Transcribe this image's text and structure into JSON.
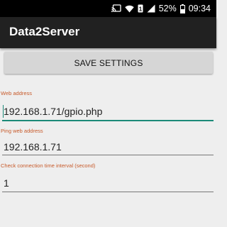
{
  "status_bar": {
    "battery_percent": "52%",
    "time": "09:34",
    "icons": [
      "cast-icon",
      "wifi-icon",
      "sim-1-icon",
      "signal-icon",
      "battery-icon"
    ]
  },
  "app_bar": {
    "title": "Data2Server"
  },
  "save_button": {
    "label": "SAVE SETTINGS"
  },
  "fields": [
    {
      "label": "Web address",
      "value": "192.168.1.71/gpio.php",
      "focused": true
    },
    {
      "label": "Ping web address",
      "value": "192.168.1.71",
      "focused": false
    },
    {
      "label": "Check connection time interval (second)",
      "value": "1",
      "focused": false
    }
  ],
  "colors": {
    "status_bar": "#000000",
    "app_bar": "#212121",
    "background": "#eeeeee",
    "button": "#d6d6d6",
    "accent": "#1b8a78",
    "label": "#c75a2a",
    "underline": "#777777"
  }
}
